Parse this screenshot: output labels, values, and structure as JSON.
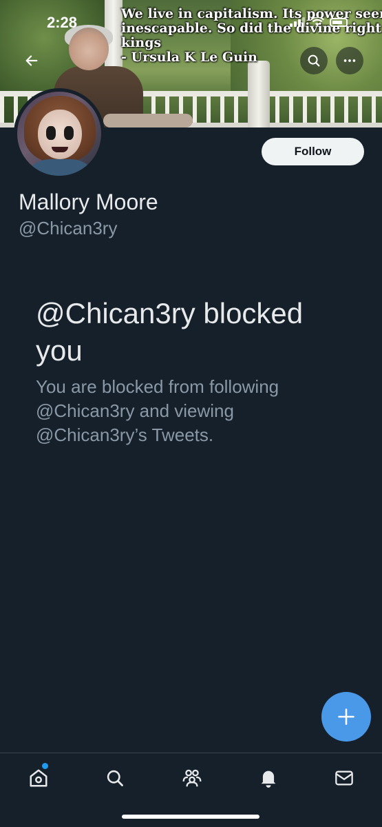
{
  "status_bar": {
    "time": "2:28"
  },
  "banner": {
    "quote_lines": [
      "We live in capitalism. Its power seems",
      "inescapable. So did the divine right of",
      "kings",
      "- Ursula K Le Guin"
    ]
  },
  "header": {
    "back_icon": "arrow-left-icon",
    "search_icon": "search-icon",
    "more_icon": "more-horizontal-icon"
  },
  "profile": {
    "display_name": "Mallory Moore",
    "handle": "@Chican3ry",
    "follow_label": "Follow"
  },
  "blocked_notice": {
    "title": "@Chican3ry blocked you",
    "body": "You are blocked from following @Chican3ry and viewing @Chican3ry’s Tweets."
  },
  "fab": {
    "icon": "plus-icon"
  },
  "tab_bar": {
    "items": [
      {
        "name": "home",
        "icon": "home-icon",
        "has_badge_dot": true
      },
      {
        "name": "search",
        "icon": "search-icon"
      },
      {
        "name": "communities",
        "icon": "communities-icon"
      },
      {
        "name": "notifications",
        "icon": "bell-icon"
      },
      {
        "name": "messages",
        "icon": "envelope-icon"
      }
    ]
  },
  "colors": {
    "background": "#15202b",
    "accent": "#1d9bf0",
    "fab": "#4a99e9",
    "secondary_text": "#8b98a5",
    "primary_text": "#e7e9ea"
  }
}
